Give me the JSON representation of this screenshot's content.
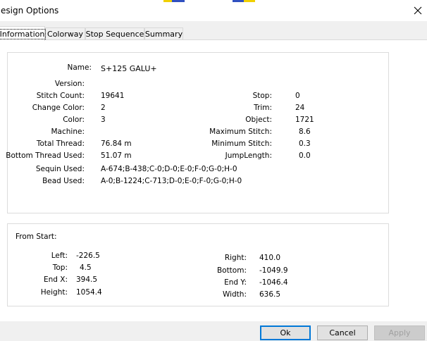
{
  "window": {
    "title": "esign Options"
  },
  "tabs": [
    {
      "label": "Information"
    },
    {
      "label": "Colorway"
    },
    {
      "label": "Stop Sequence"
    },
    {
      "label": "Summary"
    }
  ],
  "info": {
    "name_label": "Name:",
    "name_value": "S+125 GALU+",
    "version_label": "Version:",
    "version_value": "",
    "stitch_count_label": "Stitch Count:",
    "stitch_count_value": "19641",
    "change_color_label": "Change Color:",
    "change_color_value": "2",
    "color_label": "Color:",
    "color_value": "3",
    "machine_label": "Machine:",
    "machine_value": "",
    "total_thread_label": "Total Thread:",
    "total_thread_value": "76.84 m",
    "bottom_thread_label": "Bottom Thread Used:",
    "bottom_thread_value": "51.07 m",
    "sequin_label": "Sequin Used:",
    "sequin_value": "A-674;B-438;C-0;D-0;E-0;F-0;G-0;H-0",
    "bead_label": "Bead Used:",
    "bead_value": "A-0;B-1224;C-713;D-0;E-0;F-0;G-0;H-0",
    "stop_label": "Stop:",
    "stop_value": "0",
    "trim_label": "Trim:",
    "trim_value": "24",
    "object_label": "Object:",
    "object_value": "1721",
    "max_stitch_label": "Maximum Stitch:",
    "max_stitch_value": "8.6",
    "min_stitch_label": "Minimum Stitch:",
    "min_stitch_value": "0.3",
    "jump_label": "JumpLength:",
    "jump_value": "0.0"
  },
  "from_start": {
    "heading": "From Start:",
    "left_label": "Left:",
    "left_value": "-226.5",
    "top_label": "Top:",
    "top_value": "4.5",
    "endx_label": "End X:",
    "endx_value": "394.5",
    "height_label": "Height:",
    "height_value": "1054.4",
    "right_label": "Right:",
    "right_value": "410.0",
    "bottom_label": "Bottom:",
    "bottom_value": "-1049.9",
    "endy_label": "End Y:",
    "endy_value": "-1046.4",
    "width_label": "Width:",
    "width_value": "636.5"
  },
  "buttons": {
    "ok": "Ok",
    "cancel": "Cancel",
    "apply": "Apply"
  }
}
